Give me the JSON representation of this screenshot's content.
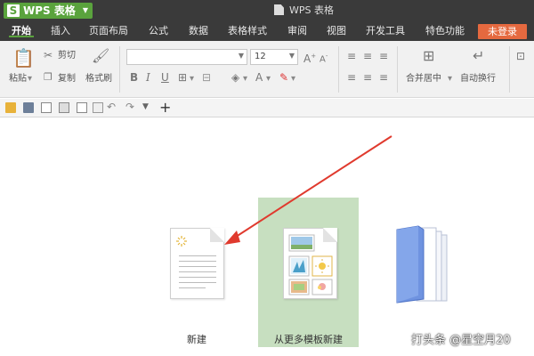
{
  "app": {
    "logo": "S",
    "name": "WPS 表格",
    "window_title": "WPS 表格"
  },
  "menu": {
    "items": [
      "开始",
      "插入",
      "页面布局",
      "公式",
      "数据",
      "表格样式",
      "审阅",
      "视图",
      "开发工具",
      "特色功能"
    ],
    "login_label": "未登录"
  },
  "ribbon": {
    "paste_label": "粘贴",
    "cut_label": "剪切",
    "copy_label": "复制",
    "format_painter_label": "格式刷",
    "font_name_value": "",
    "font_size_value": "12",
    "bold": "B",
    "italic": "I",
    "underline": "U",
    "merge_center_label": "合并居中",
    "wrap_text_label": "自动换行"
  },
  "main": {
    "new_label": "新建",
    "template_label": "从更多模板新建"
  },
  "watermark": "打头条 @星空月20",
  "colors": {
    "app_green": "#5aa33d",
    "login_orange": "#e5693f",
    "template_highlight": "#c7dfc0",
    "arrow_red": "#e03a2e",
    "folder_blue": "#6f93e0"
  }
}
